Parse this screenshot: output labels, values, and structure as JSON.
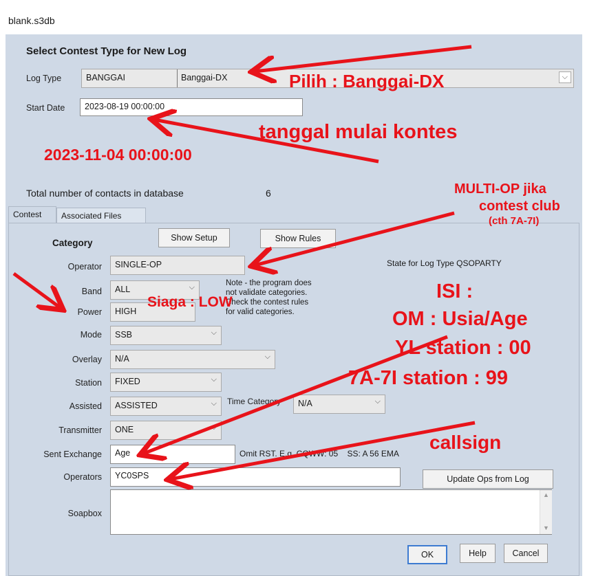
{
  "window": {
    "title": "blank.s3db"
  },
  "header": {
    "heading": "Select Contest Type for New Log"
  },
  "log_type": {
    "label": "Log Type",
    "code": "BANGGAI",
    "name": "Banggai-DX"
  },
  "start_date": {
    "label": "Start Date",
    "value": "2023-08-19 00:00:00"
  },
  "contacts": {
    "label": "Total number of contacts in database",
    "count": "6"
  },
  "tabs": [
    {
      "label": "Contest",
      "active": true
    },
    {
      "label": "Associated Files",
      "active": false
    }
  ],
  "category": {
    "heading": "Category",
    "show_setup": "Show Setup",
    "show_rules": "Show Rules",
    "operator": {
      "label": "Operator",
      "value": "SINGLE-OP"
    },
    "band": {
      "label": "Band",
      "value": "ALL"
    },
    "power": {
      "label": "Power",
      "value": "HIGH"
    },
    "mode": {
      "label": "Mode",
      "value": "SSB"
    },
    "overlay": {
      "label": "Overlay",
      "value": "N/A"
    },
    "station": {
      "label": "Station",
      "value": "FIXED"
    },
    "assisted": {
      "label": "Assisted",
      "value": "ASSISTED"
    },
    "time_category": {
      "label": "Time Category",
      "value": "N/A"
    },
    "transmitter": {
      "label": "Transmitter",
      "value": "ONE"
    },
    "note": [
      "Note -  the program does",
      "not validate categories.",
      "Check the contest rules",
      "for valid categories."
    ],
    "state_label": "State for Log Type QSOPARTY"
  },
  "sent_exchange": {
    "label": "Sent Exchange",
    "value": "Age",
    "hint": "Omit RST. E.g. CQWW: 05    SS: A 56 EMA"
  },
  "operators": {
    "label": "Operators",
    "value": "YC0SPS",
    "update_button": "Update Ops from Log"
  },
  "soapbox": {
    "label": "Soapbox",
    "value": ""
  },
  "footer": {
    "ok": "OK",
    "help": "Help",
    "cancel": "Cancel"
  },
  "annotations": {
    "pilih": "Pilih : Banggai-DX",
    "tanggal": "tanggal mulai kontes",
    "date": "2023-11-04 00:00:00",
    "multi_op_1": "MULTI-OP jika",
    "multi_op_2": "contest club",
    "multi_op_3": "(cth 7A-7I)",
    "siaga": "Siaga : LOW",
    "isi": "ISI :",
    "om": "OM : Usia/Age",
    "yl": "YL station : 00",
    "club": "7A-7I station : 99",
    "callsign": "callsign",
    "color": "#e8131a"
  }
}
